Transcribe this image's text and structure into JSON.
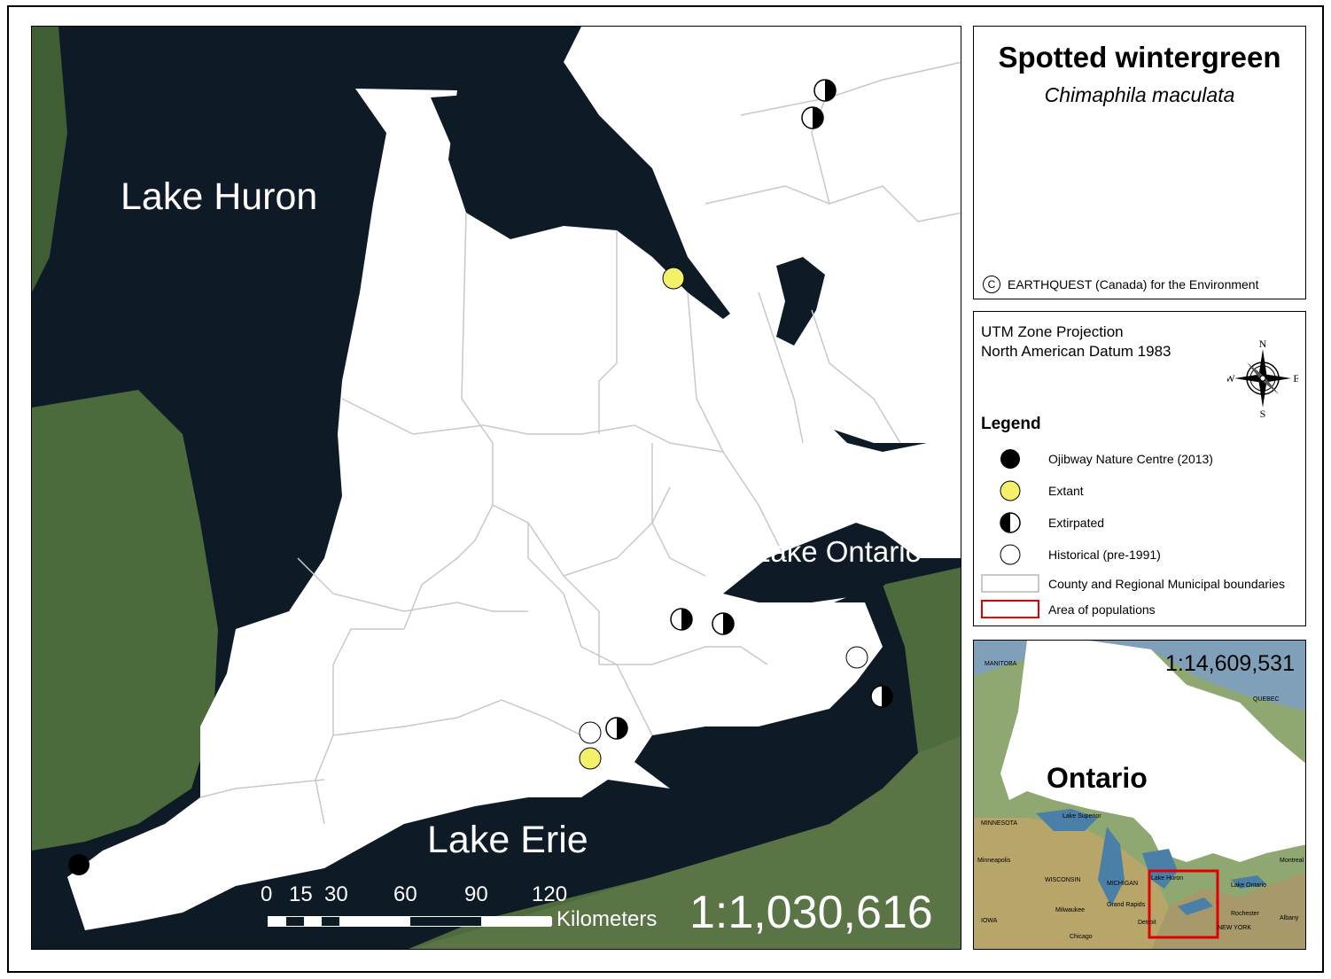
{
  "title": "Spotted wintergreen",
  "scientific_name": "Chimaphila maculata",
  "copyright": "EARTHQUEST (Canada) for the Environment",
  "copyright_symbol": "C",
  "projection": [
    "UTM Zone Projection",
    "North American Datum 1983"
  ],
  "compass": {
    "n": "N",
    "s": "S",
    "e": "E",
    "w": "W"
  },
  "legend": {
    "title": "Legend",
    "items": [
      {
        "symbol": "black-dot",
        "label": "Ojibway Nature Centre (2013)"
      },
      {
        "symbol": "yellow-dot",
        "label": "Extant"
      },
      {
        "symbol": "half-dot",
        "label": "Extirpated"
      },
      {
        "symbol": "white-dot",
        "label": "Historical (pre-1991)"
      },
      {
        "symbol": "grey-rect",
        "label": "County and Regional Municipal boundaries"
      },
      {
        "symbol": "red-rect",
        "label": "Area of populations"
      }
    ]
  },
  "map": {
    "water_labels": [
      "Lake Huron",
      "Lake Ontario",
      "Lake Erie"
    ],
    "scale_ratio": "1:1,030,616",
    "scale_bar": {
      "ticks": [
        "0",
        "15",
        "30",
        "60",
        "90",
        "120"
      ],
      "unit": "Kilometers"
    }
  },
  "inset": {
    "scale_ratio": "1:14,609,531",
    "region_label": "Ontario",
    "place_labels": [
      "MANITOBA",
      "QUEBEC",
      "MINNESOTA",
      "WISCONSIN",
      "MICHIGAN",
      "IOWA",
      "Lake Superior",
      "Lake Huron",
      "Lake Ontario",
      "Minneapolis",
      "Milwaukee",
      "Chicago",
      "Grand Rapids",
      "Detroit",
      "Rochester",
      "Albany",
      "Montreal",
      "NEW YORK"
    ]
  },
  "colors": {
    "water": "#0d1a24",
    "land_green": "#4a6a3a",
    "ontario": "#ffffff",
    "boundary": "#c8c8c8",
    "extant": "#f5f06a",
    "area_box": "#e00000"
  }
}
